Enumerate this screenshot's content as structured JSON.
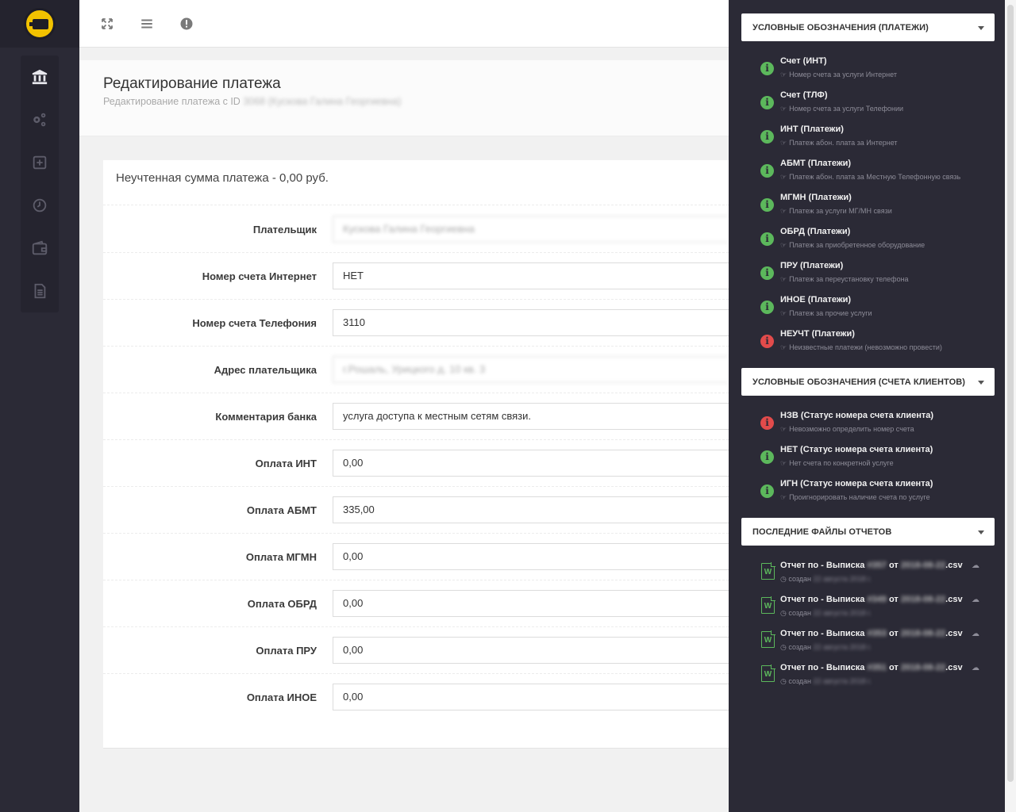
{
  "nav": {
    "items": [
      {
        "name": "sidebar-item-bank",
        "active": true
      },
      {
        "name": "sidebar-item-settings",
        "active": false
      },
      {
        "name": "sidebar-item-add",
        "active": false
      },
      {
        "name": "sidebar-item-history",
        "active": false
      },
      {
        "name": "sidebar-item-wallet",
        "active": false
      },
      {
        "name": "sidebar-item-documents",
        "active": false
      }
    ]
  },
  "page": {
    "title": "Редактирование платежа",
    "subtitle_prefix": "Редактирование платежа с ID",
    "subtitle_id": "3068",
    "subtitle_name": "(Кускова Галина Георгиевна)"
  },
  "form": {
    "summary": "Неучтенная сумма платежа - 0,00 руб.",
    "fields": [
      {
        "label": "Плательщик",
        "value": "Кускова Галина Георгиевна",
        "blurred": true
      },
      {
        "label": "Номер счета Интернет",
        "value": "НЕТ",
        "blurred": false
      },
      {
        "label": "Номер счета Телефония",
        "value": "3110",
        "blurred": false
      },
      {
        "label": "Адрес плательщика",
        "value": "г.Рошаль, Урицкого д. 10 кв. 3",
        "blurred": true
      },
      {
        "label": "Комментария банка",
        "value": "услуга доступа к местным сетям связи.",
        "blurred": false
      },
      {
        "label": "Оплата ИНТ",
        "value": "0,00",
        "blurred": false
      },
      {
        "label": "Оплата АБМТ",
        "value": "335,00",
        "blurred": false
      },
      {
        "label": "Оплата МГМН",
        "value": "0,00",
        "blurred": false
      },
      {
        "label": "Оплата ОБРД",
        "value": "0,00",
        "blurred": false
      },
      {
        "label": "Оплата ПРУ",
        "value": "0,00",
        "blurred": false
      },
      {
        "label": "Оплата ИНОЕ",
        "value": "0,00",
        "blurred": false
      }
    ]
  },
  "panel": {
    "payments_header": "УСЛОВНЫЕ ОБОЗНАЧЕНИЯ (ПЛАТЕЖИ)",
    "payments": [
      {
        "title": "Счет (ИНТ)",
        "desc": "Номер счета за услуги Интернет",
        "status": "ok"
      },
      {
        "title": "Счет (ТЛФ)",
        "desc": "Номер счета за услуги Телефонии",
        "status": "ok"
      },
      {
        "title": "ИНТ (Платежи)",
        "desc": "Платеж абон. плата за Интернет",
        "status": "ok"
      },
      {
        "title": "АБМТ (Платежи)",
        "desc": "Платеж абон. плата за Местную Телефонную связь",
        "status": "ok"
      },
      {
        "title": "МГМН (Платежи)",
        "desc": "Платеж за услуги МГ/МН связи",
        "status": "ok"
      },
      {
        "title": "ОБРД (Платежи)",
        "desc": "Платеж за приобретенное оборудование",
        "status": "ok"
      },
      {
        "title": "ПРУ (Платежи)",
        "desc": "Платеж за переустановку телефона",
        "status": "ok"
      },
      {
        "title": "ИНОЕ (Платежи)",
        "desc": "Платеж за прочие услуги",
        "status": "ok"
      },
      {
        "title": "НЕУЧТ (Платежи)",
        "desc": "Неизвестные платежи (невозможно провести)",
        "status": "error"
      }
    ],
    "accounts_header": "УСЛОВНЫЕ ОБОЗНАЧЕНИЯ (СЧЕТА КЛИЕНТОВ)",
    "accounts": [
      {
        "title": "НЗВ (Статус номера счета клиента)",
        "desc": "Невозможно определить номер счета",
        "status": "error"
      },
      {
        "title": "НЕТ (Статус номера счета клиента)",
        "desc": "Нет счета по конкретной услуге",
        "status": "ok"
      },
      {
        "title": "ИГН (Статус номера счета клиента)",
        "desc": "Проигнорировать наличие счета по услуге",
        "status": "ok"
      }
    ],
    "files_header": "ПОСЛЕДНИЕ ФАЙЛЫ ОТЧЕТОВ",
    "files": [
      {
        "prefix": "Отчет по - Выписка",
        "num": "#357",
        "mid": "от",
        "date": "2018-08-22",
        "ext": ".csv",
        "created_label": "создан",
        "created": "22 августа 2018 г."
      },
      {
        "prefix": "Отчет по - Выписка",
        "num": "#349",
        "mid": "от",
        "date": "2018-08-22",
        "ext": ".csv",
        "created_label": "создан",
        "created": "22 августа 2018 г."
      },
      {
        "prefix": "Отчет по - Выписка",
        "num": "#353",
        "mid": "от",
        "date": "2018-08-22",
        "ext": ".csv",
        "created_label": "создан",
        "created": "22 августа 2018 г."
      },
      {
        "prefix": "Отчет по - Выписка",
        "num": "#351",
        "mid": "от",
        "date": "2018-08-22",
        "ext": ".csv",
        "created_label": "создан",
        "created": "22 августа 2018 г."
      }
    ]
  }
}
